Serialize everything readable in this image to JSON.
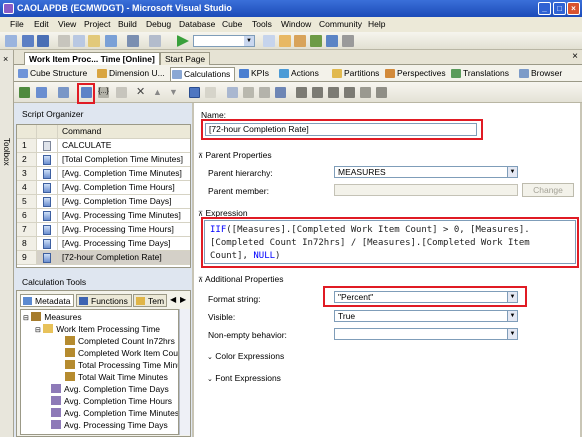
{
  "window": {
    "title": "CAOLAPDB (ECMWDGT) - Microsoft Visual Studio"
  },
  "menu": [
    "File",
    "Edit",
    "View",
    "Project",
    "Build",
    "Debug",
    "Database",
    "Cube",
    "Tools",
    "Window",
    "Community",
    "Help"
  ],
  "left_strip": {
    "label": "Toolbox"
  },
  "doc_tabs": [
    {
      "label": "Work Item Proc... Time [Online]",
      "active": true
    },
    {
      "label": "Start Page",
      "active": false
    }
  ],
  "designer_tabs": [
    {
      "label": "Cube Structure",
      "active": false
    },
    {
      "label": "Dimension U...",
      "active": false
    },
    {
      "label": "Calculations",
      "active": true
    },
    {
      "label": "KPIs",
      "active": false
    },
    {
      "label": "Actions",
      "active": false
    },
    {
      "label": "Partitions",
      "active": false
    },
    {
      "label": "Perspectives",
      "active": false
    },
    {
      "label": "Translations",
      "active": false
    },
    {
      "label": "Browser",
      "active": false
    }
  ],
  "script_organizer": {
    "title": "Script Organizer",
    "column_header": "Command",
    "rows": [
      {
        "num": "1",
        "command": "CALCULATE"
      },
      {
        "num": "2",
        "command": "[Total Completion Time Minutes]"
      },
      {
        "num": "3",
        "command": "[Avg. Completion Time Minutes]"
      },
      {
        "num": "4",
        "command": "[Avg. Completion Time Hours]"
      },
      {
        "num": "5",
        "command": "[Avg. Completion Time Days]"
      },
      {
        "num": "6",
        "command": "[Avg. Processing Time Minutes]"
      },
      {
        "num": "7",
        "command": "[Avg. Processing Time Hours]"
      },
      {
        "num": "8",
        "command": "[Avg. Processing Time Days]"
      },
      {
        "num": "9",
        "command": "[72-hour Completion Rate]"
      }
    ],
    "selected_index": 8
  },
  "calculation_tools": {
    "title": "Calculation Tools",
    "tabs": [
      "Metadata",
      "Functions",
      "Tem"
    ],
    "tree": [
      {
        "label": "Measures",
        "level": 0
      },
      {
        "label": "Work Item Processing Time",
        "level": 1
      },
      {
        "label": "Completed Count In72hrs",
        "level": 2
      },
      {
        "label": "Completed Work Item Count",
        "level": 2
      },
      {
        "label": "Total Processing Time Minute",
        "level": 2
      },
      {
        "label": "Total Wait Time Minutes",
        "level": 2
      },
      {
        "label": "Avg. Completion Time Days",
        "level": 1
      },
      {
        "label": "Avg. Completion Time Hours",
        "level": 1
      },
      {
        "label": "Avg. Completion Time Minutes",
        "level": 1
      },
      {
        "label": "Avg. Processing Time Days",
        "level": 1
      }
    ]
  },
  "form": {
    "name_label": "Name:",
    "name_value": "[72-hour Completion Rate]",
    "parent_properties": "Parent Properties",
    "parent_hierarchy_label": "Parent hierarchy:",
    "parent_hierarchy_value": "MEASURES",
    "parent_member_label": "Parent member:",
    "parent_member_value": "",
    "change_button": "Change",
    "expression_header": "Expression",
    "expression_parts": {
      "p1": "IIF",
      "p2": "([Measures].[Completed Work Item Count] > 0, [Measures].",
      "p3": "[Completed Count In72hrs] / [Measures].[Completed Work Item",
      "p4": "Count], ",
      "p5": "NULL",
      "p6": ")"
    },
    "additional_properties": "Additional Properties",
    "format_string_label": "Format string:",
    "format_string_value": "\"Percent\"",
    "visible_label": "Visible:",
    "visible_value": "True",
    "non_empty_label": "Non-empty behavior:",
    "non_empty_value": "",
    "color_expressions": "Color Expressions",
    "font_expressions": "Font Expressions"
  }
}
